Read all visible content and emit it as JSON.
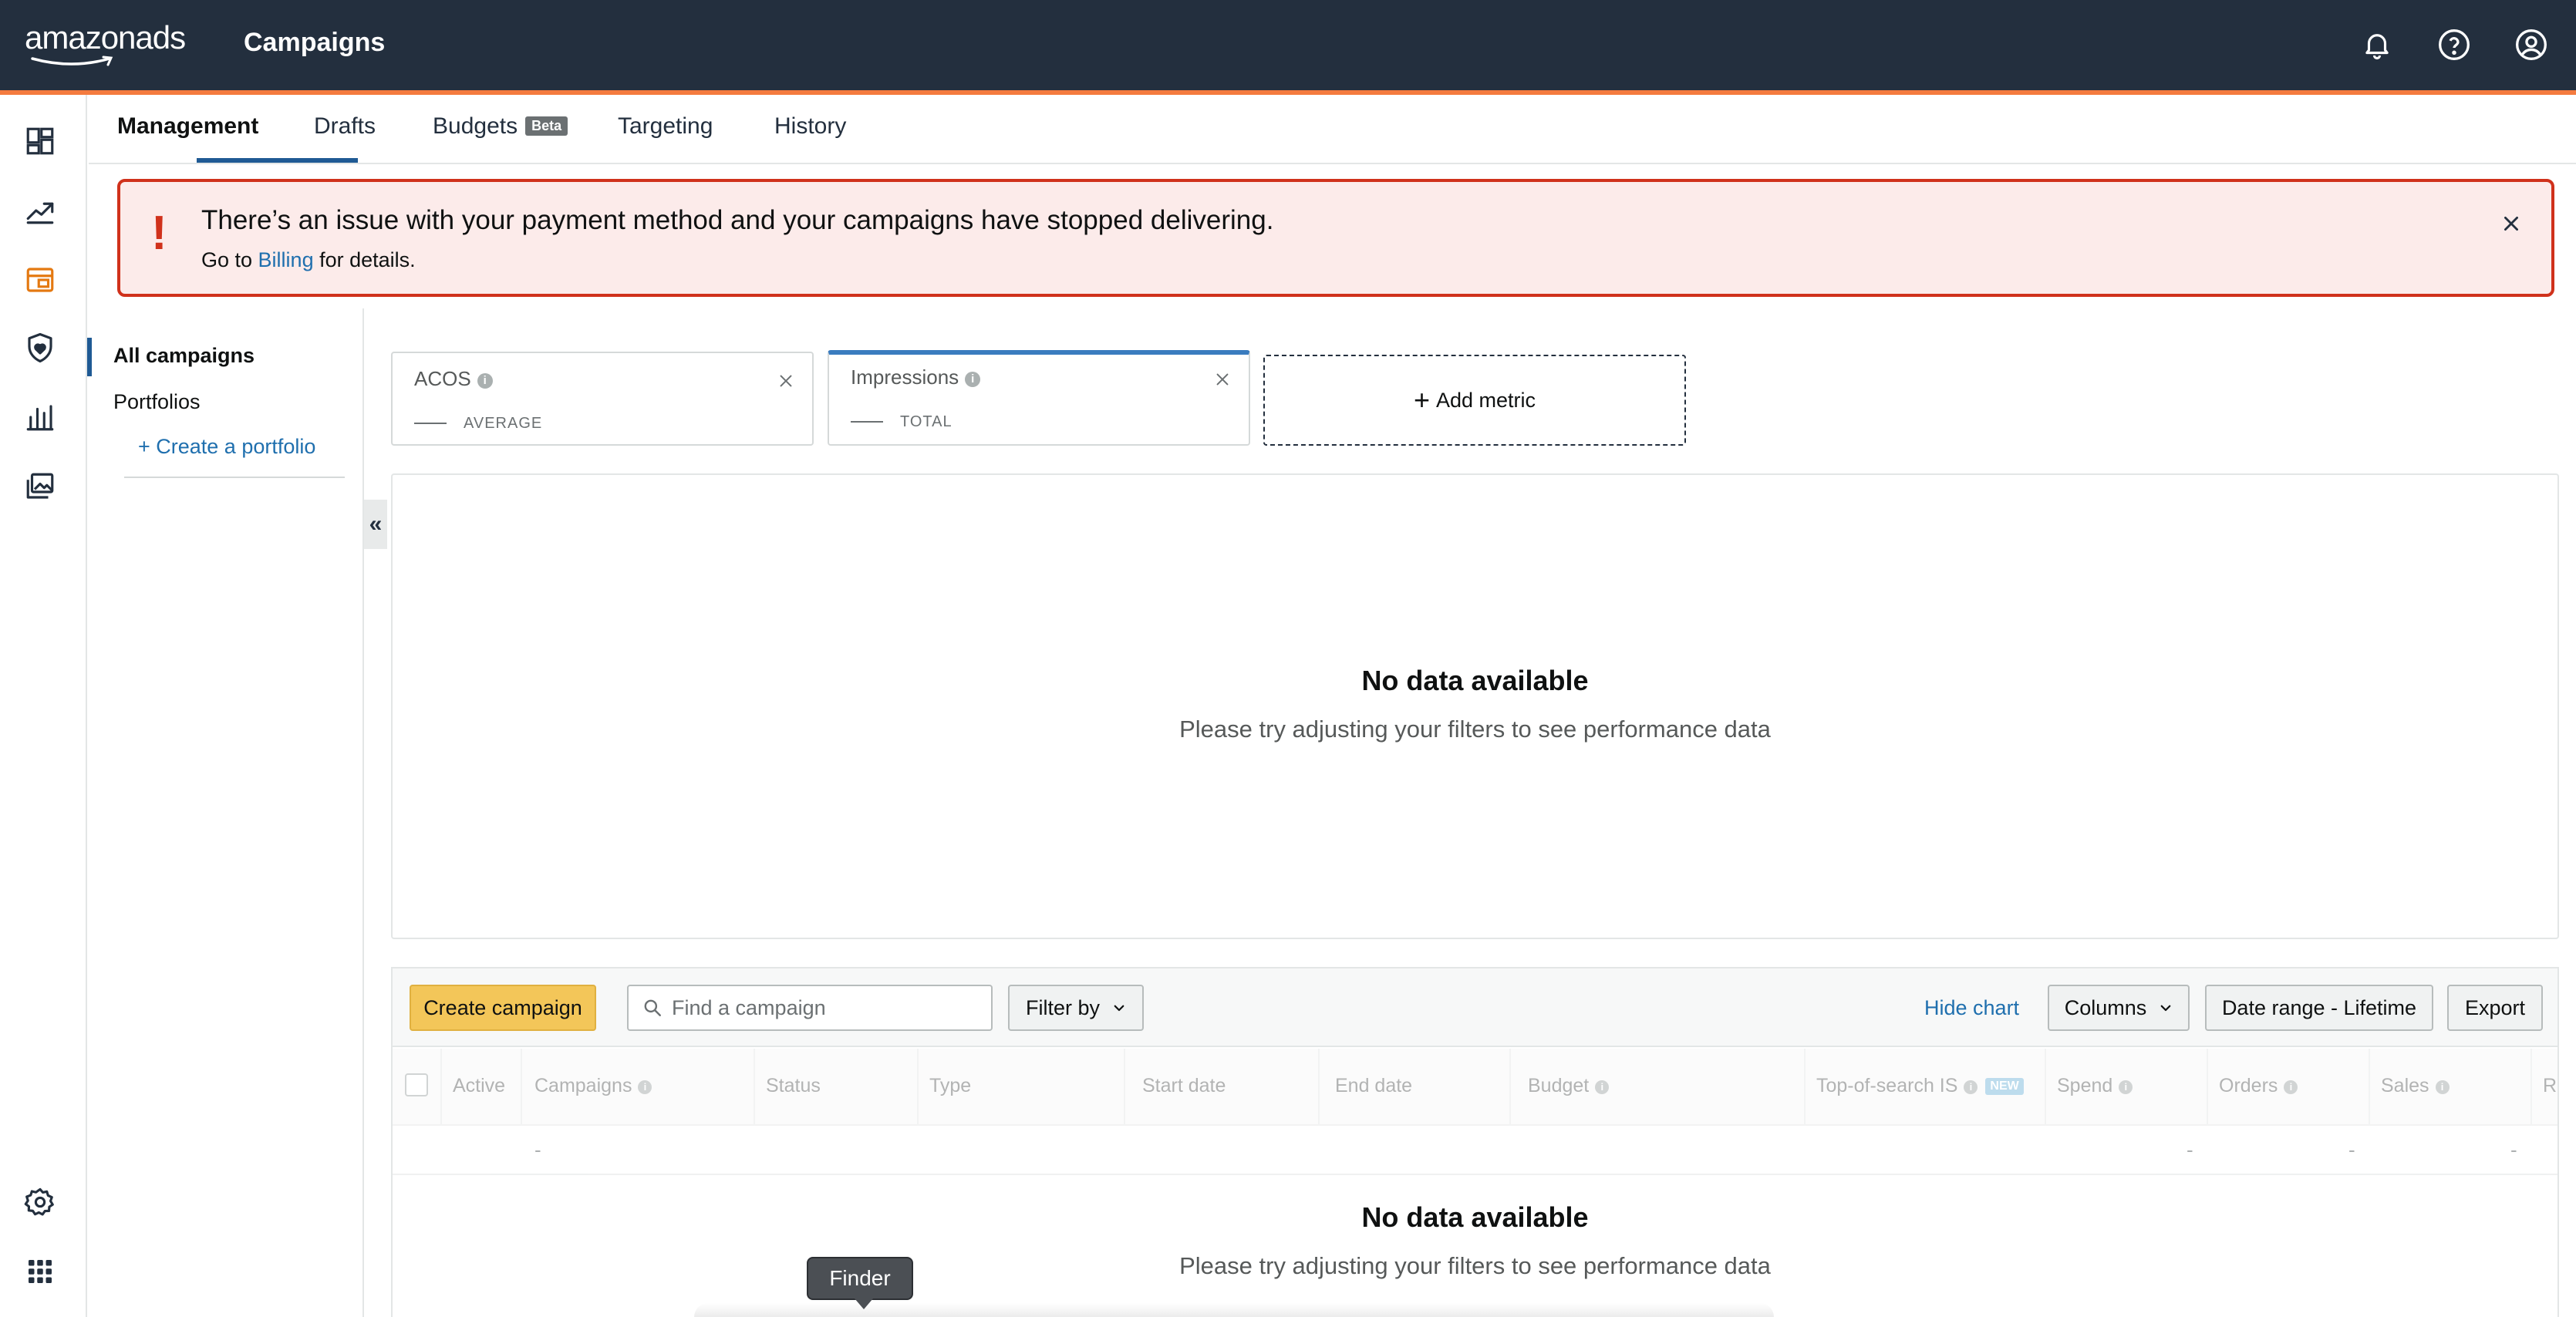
{
  "header": {
    "logo_main": "amazon",
    "logo_suffix": "ads",
    "app_title": "Campaigns",
    "icons": [
      "bell-icon",
      "help-icon",
      "account-icon"
    ]
  },
  "rail": {
    "icons": [
      "dashboard-icon",
      "trend-icon",
      "campaigns-icon",
      "brand-shield-icon",
      "reports-icon",
      "media-library-icon",
      "settings-icon",
      "apps-grid-icon"
    ],
    "active_color": "#e47911"
  },
  "tabs": [
    {
      "label": "Management",
      "active": true
    },
    {
      "label": "Drafts"
    },
    {
      "label": "Budgets",
      "badge": "Beta"
    },
    {
      "label": "Targeting"
    },
    {
      "label": "History"
    }
  ],
  "alert": {
    "icon": "!",
    "title": "There’s an issue with your payment method and your campaigns have stopped delivering.",
    "sub_prefix": "Go to ",
    "sub_link": "Billing",
    "sub_suffix": " for details."
  },
  "sidebar": {
    "items": [
      {
        "label": "All campaigns",
        "active": true
      },
      {
        "label": "Portfolios"
      }
    ],
    "create_link": "+ Create a portfolio",
    "collapse_glyph": "«"
  },
  "metrics": [
    {
      "name": "ACOS",
      "aggregation": "AVERAGE"
    },
    {
      "name": "Impressions",
      "aggregation": "TOTAL",
      "selected": true
    }
  ],
  "add_metric_label": "Add metric",
  "chart": {
    "empty_title": "No data available",
    "empty_sub": "Please try adjusting your filters to see performance data"
  },
  "toolbar": {
    "create_campaign": "Create campaign",
    "search_placeholder": "Find a campaign",
    "filter_by": "Filter by",
    "hide_chart": "Hide chart",
    "columns": "Columns",
    "date_range": "Date range - Lifetime",
    "export": "Export"
  },
  "table": {
    "columns": [
      "Active",
      "Campaigns",
      "Status",
      "Type",
      "Start date",
      "End date",
      "Budget",
      "Top-of-search IS",
      "Spend",
      "Orders",
      "Sales",
      "R"
    ],
    "new_badge": "NEW",
    "row_placeholder": "-",
    "empty_title": "No data available",
    "empty_sub": "Please try adjusting your filters to see performance data"
  },
  "tooltip": {
    "label": "Finder"
  }
}
